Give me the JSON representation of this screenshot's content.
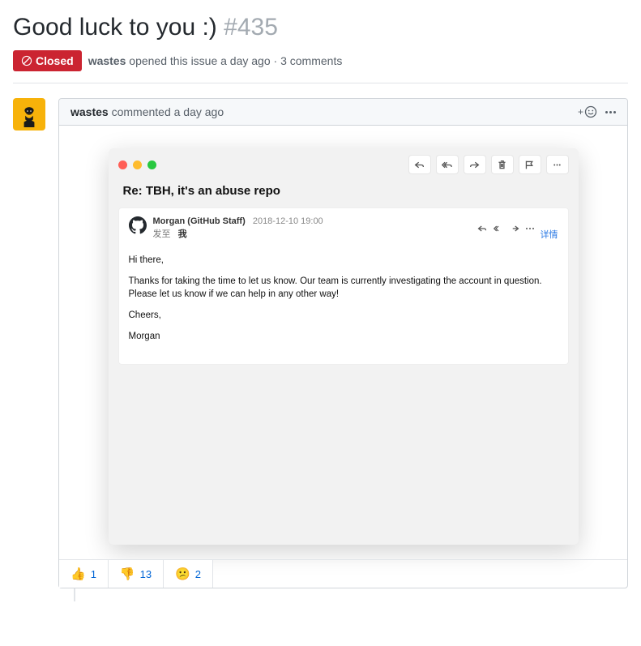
{
  "issue": {
    "title": "Good luck to you :)",
    "number": "#435",
    "state": "Closed",
    "author": "wastes",
    "opened_text": "opened this issue a day ago",
    "separator": "·",
    "comments_text": "3 comments"
  },
  "comment": {
    "author": "wastes",
    "action": "commented a day ago",
    "add_reaction_plus": "+"
  },
  "email": {
    "subject": "Re: TBH, it's an abuse repo",
    "from": "Morgan (GitHub Staff)",
    "date": "2018-12-10 19:00",
    "to_label": "发至",
    "to_value": "我",
    "details_label": "详情",
    "body": {
      "greeting": "Hi there,",
      "line1": "Thanks for taking the time to let us know. Our team is currently investigating the account in question.",
      "line2": "Please let us know if we can help in any other way!",
      "signoff": "Cheers,",
      "name": "Morgan"
    }
  },
  "reactions": [
    {
      "emoji": "👍",
      "count": "1"
    },
    {
      "emoji": "👎",
      "count": "13"
    },
    {
      "emoji": "😕",
      "count": "2"
    }
  ]
}
